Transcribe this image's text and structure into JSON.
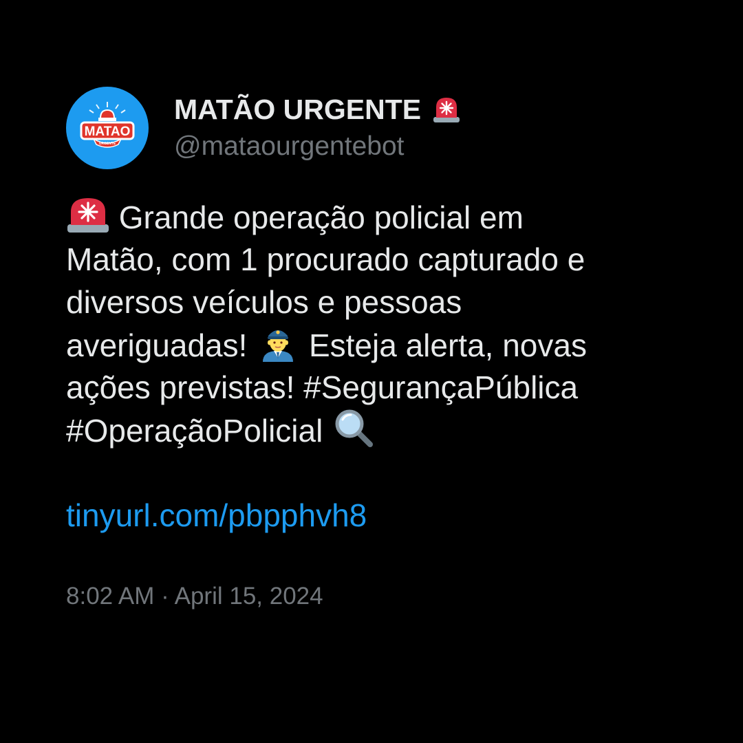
{
  "account": {
    "display_name": "MATÃO URGENTE",
    "handle": "@mataourgentebot",
    "avatar_text": "MATAO",
    "avatar_subtext": "URGENTE"
  },
  "tweet": {
    "lines": [
      {
        "emoji_before": "police-car-light",
        "text": "Grande operação policial em"
      },
      {
        "text": "Matão, com 1 procurado capturado e"
      },
      {
        "text": "diversos veículos e pessoas"
      },
      {
        "text_a": "averiguadas!",
        "emoji_mid": "police-officer",
        "text_b": "Esteja alerta, novas"
      },
      {
        "text": "ações previstas! #SegurançaPública"
      },
      {
        "text": "#OperaçãoPolicial",
        "emoji_after": "magnifying-glass"
      }
    ],
    "link": "tinyurl.com/pbpphvh8",
    "time": "8:02 AM",
    "separator": "·",
    "date": "April 15, 2024"
  },
  "colors": {
    "background": "#000000",
    "text": "#e7e9ea",
    "secondary": "#71767b",
    "link": "#1d9bf0",
    "avatar_bg": "#1d9bf0"
  }
}
